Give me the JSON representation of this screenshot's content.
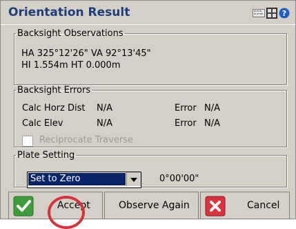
{
  "window": {
    "title": "Orientation Result"
  },
  "titlebar_icons": [
    "keyboard-icon",
    "grid-icon",
    "help-icon"
  ],
  "backsight_observations": {
    "legend": "Backsight Observations",
    "line1": "HA 325°12'26\"  VA 92°13'45\"",
    "line2": "HI 1.554m  HT 0.000m"
  },
  "backsight_errors": {
    "legend": "Backsight Errors",
    "calc_horz_dist_label": "Calc Horz Dist",
    "calc_horz_dist_value": "N/A",
    "horz_error_label": "Error",
    "horz_error_value": "N/A",
    "calc_elev_label": "Calc Elev",
    "calc_elev_value": "N/A",
    "elev_error_label": "Error",
    "elev_error_value": "N/A",
    "reciprocate_label": "Reciprocate Traverse"
  },
  "plate_setting": {
    "legend": "Plate Setting",
    "selected": "Set to Zero",
    "angle": "0°00'00\""
  },
  "buttons": {
    "accept": "Accept",
    "observe_again": "Observe Again",
    "cancel": "Cancel"
  },
  "colors": {
    "title": "#1f3d7a",
    "highlight_ring": "#d8323c",
    "selection": "#0a246a"
  }
}
